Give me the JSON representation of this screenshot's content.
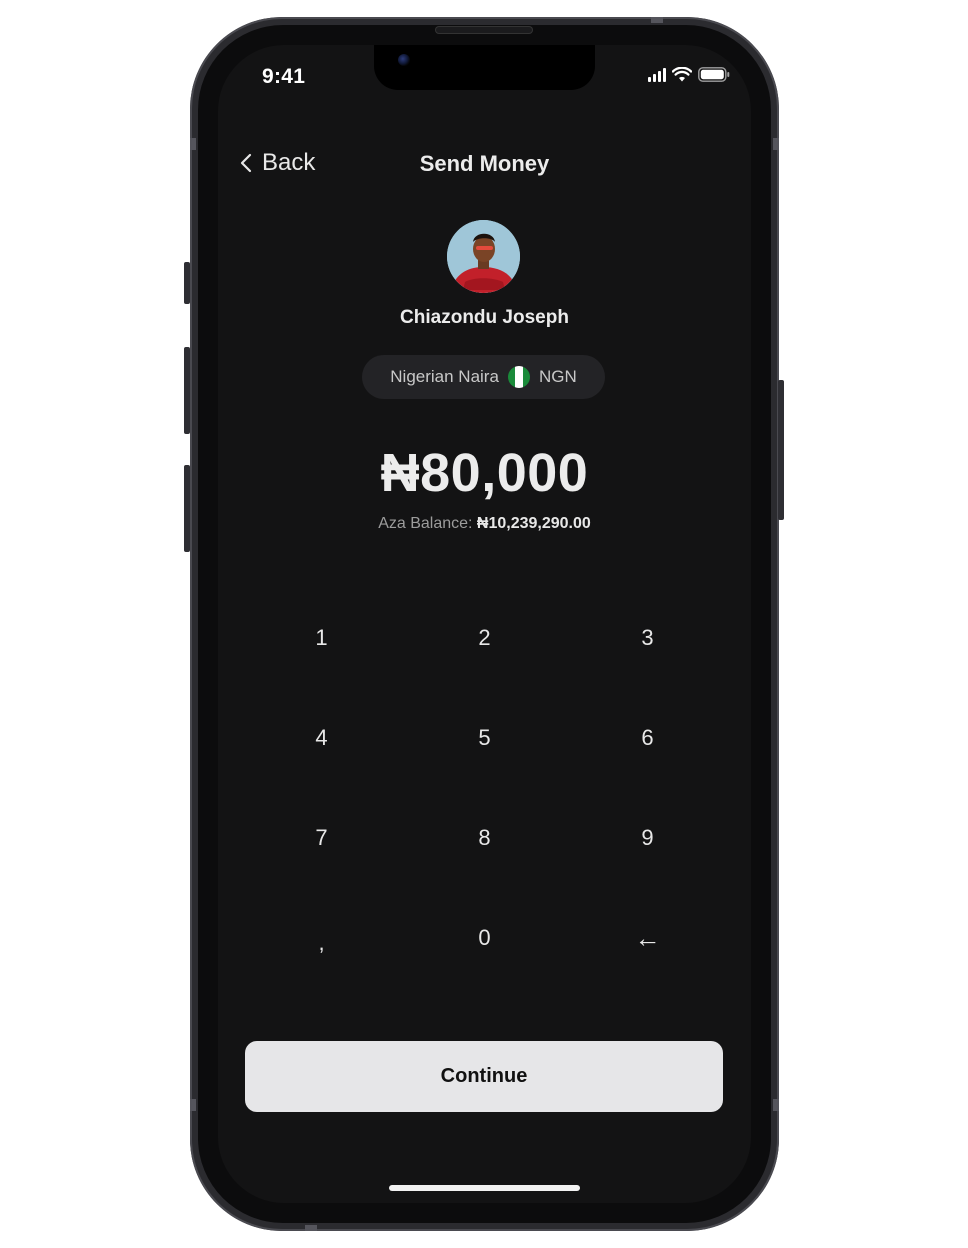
{
  "status_bar": {
    "time": "9:41"
  },
  "header": {
    "back_label": "Back",
    "title": "Send Money"
  },
  "recipient": {
    "name": "Chiazondu Joseph"
  },
  "currency": {
    "name": "Nigerian Naira",
    "code": "NGN",
    "flag": "nigeria-flag-icon"
  },
  "amount": {
    "display": "₦80,000"
  },
  "balance": {
    "label": "Aza Balance:",
    "value": "₦10,239,290.00"
  },
  "keypad": {
    "keys": [
      "1",
      "2",
      "3",
      "4",
      "5",
      "6",
      "7",
      "8",
      "9",
      ",",
      "0",
      "←"
    ]
  },
  "continue_label": "Continue",
  "colors": {
    "background": "#131314",
    "text": "#ececec",
    "muted": "#9c9c9c",
    "pill": "#232326",
    "button": "#e6e6e8",
    "flag_green": "#1a8a3a"
  }
}
